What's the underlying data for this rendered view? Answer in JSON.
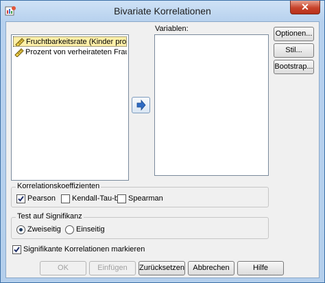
{
  "window": {
    "title": "Bivariate Korrelationen",
    "close_glyph": "✕"
  },
  "source_list": {
    "items": [
      {
        "label": "Fruchtbarkeitsrate (Kinder pro ...",
        "icon": "scale-ruler-icon",
        "selected": true
      },
      {
        "label": "Prozent von verheirateten Frau...",
        "icon": "scale-ruler-icon",
        "selected": false
      }
    ]
  },
  "variables": {
    "label": "Variablen:"
  },
  "side_buttons": {
    "options": "Optionen...",
    "style": "Stil...",
    "bootstrap": "Bootstrap..."
  },
  "correlation": {
    "title": "Korrelationskoeffizienten",
    "pearson": "Pearson",
    "pearson_checked": true,
    "kendall": "Kendall-Tau-b",
    "kendall_checked": false,
    "spearman": "Spearman",
    "spearman_checked": false
  },
  "significance": {
    "title": "Test auf Signifikanz",
    "two_tailed": "Zweiseitig",
    "two_tailed_selected": true,
    "one_tailed": "Einseitig",
    "one_tailed_selected": false
  },
  "flag_significant": {
    "label": "Signifikante Korrelationen markieren",
    "checked": true
  },
  "buttons": {
    "ok": "OK",
    "paste": "Einfügen",
    "reset": "Zurücksetzen",
    "cancel": "Abbrechen",
    "help": "Hilfe"
  },
  "colors": {
    "selection": "#fff0a8",
    "dialog_bg": "#f0f0f0",
    "title_bg": "#b7d1ee",
    "close_red": "#c7432b"
  }
}
